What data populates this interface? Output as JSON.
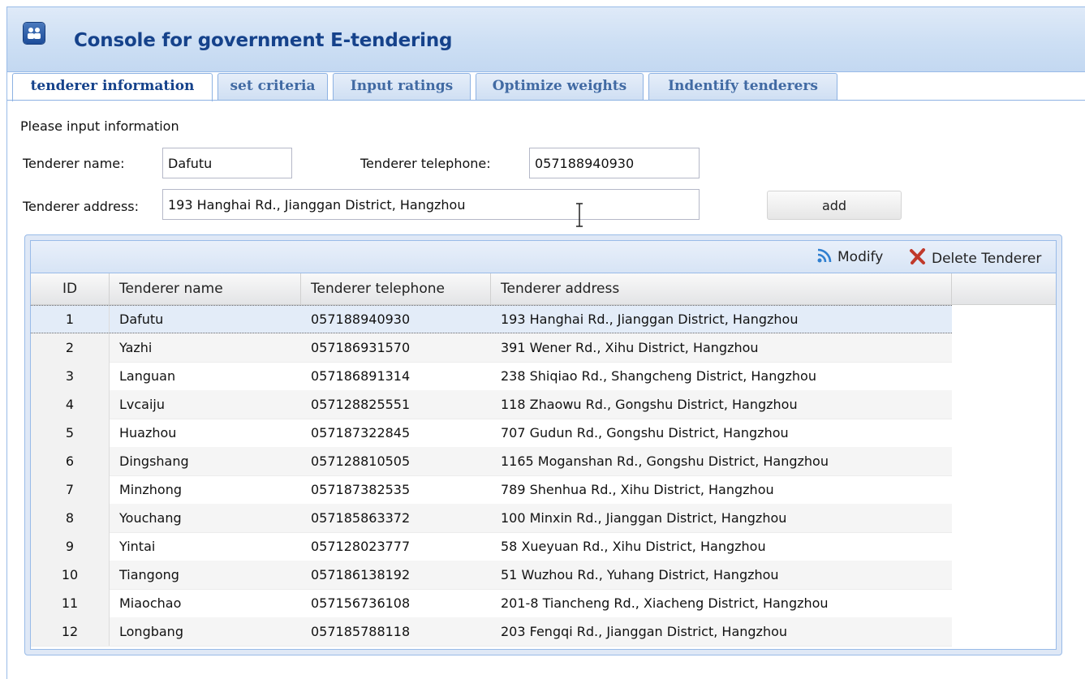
{
  "app": {
    "title": "Console for government E-tendering"
  },
  "tabs": [
    {
      "label": "tenderer information",
      "active": true
    },
    {
      "label": "set criteria",
      "active": false
    },
    {
      "label": "Input ratings",
      "active": false
    },
    {
      "label": "Optimize weights",
      "active": false
    },
    {
      "label": "Indentify tenderers",
      "active": false
    }
  ],
  "form": {
    "prompt": "Please input information",
    "name_label": "Tenderer name:",
    "name_value": "Dafutu",
    "phone_label": "Tenderer telephone:",
    "phone_value": "057188940930",
    "address_label": "Tenderer address:",
    "address_value": "193 Hanghai Rd., Jianggan District, Hangzhou",
    "add_label": "add"
  },
  "toolbar": {
    "modify_label": "Modify",
    "delete_label": "Delete Tenderer"
  },
  "grid": {
    "columns": [
      "ID",
      "Tenderer name",
      "Tenderer telephone",
      "Tenderer address"
    ],
    "selected_row": 1,
    "rows": [
      {
        "id": "1",
        "name": "Dafutu",
        "phone": "057188940930",
        "address": "193 Hanghai Rd., Jianggan District, Hangzhou"
      },
      {
        "id": "2",
        "name": "Yazhi",
        "phone": "057186931570",
        "address": "391 Wener Rd., Xihu District, Hangzhou"
      },
      {
        "id": "3",
        "name": "Languan",
        "phone": "057186891314",
        "address": "238 Shiqiao Rd., Shangcheng District, Hangzhou"
      },
      {
        "id": "4",
        "name": "Lvcaiju",
        "phone": "057128825551",
        "address": "118 Zhaowu Rd., Gongshu District, Hangzhou"
      },
      {
        "id": "5",
        "name": "Huazhou",
        "phone": "057187322845",
        "address": "707 Gudun Rd., Gongshu District, Hangzhou"
      },
      {
        "id": "6",
        "name": "Dingshang",
        "phone": "057128810505",
        "address": "1165 Moganshan Rd., Gongshu District, Hangzhou"
      },
      {
        "id": "7",
        "name": "Minzhong",
        "phone": "057187382535",
        "address": "789 Shenhua Rd., Xihu District, Hangzhou"
      },
      {
        "id": "8",
        "name": "Youchang",
        "phone": "057185863372",
        "address": "100 Minxin Rd., Jianggan District, Hangzhou"
      },
      {
        "id": "9",
        "name": "Yintai",
        "phone": "057128023777",
        "address": "58 Xueyuan Rd., Xihu District, Hangzhou"
      },
      {
        "id": "10",
        "name": "Tiangong",
        "phone": "057186138192",
        "address": "51 Wuzhou Rd., Yuhang District, Hangzhou"
      },
      {
        "id": "11",
        "name": "Miaochao",
        "phone": "057156736108",
        "address": "201-8 Tiancheng Rd., Xiacheng District, Hangzhou"
      },
      {
        "id": "12",
        "name": "Longbang",
        "phone": "057185788118",
        "address": "203 Fengqi Rd., Jianggan District, Hangzhou"
      }
    ]
  },
  "colors": {
    "title": "#15428b",
    "tab_text": "#416aa3",
    "border": "#99bbe8",
    "delete_icon": "#c0392b",
    "modify_icon": "#2f7fd0"
  },
  "icons": {
    "app": "people-icon",
    "modify": "rss-feed-icon",
    "delete": "red-x-icon",
    "cursor": "text-cursor-icon"
  }
}
